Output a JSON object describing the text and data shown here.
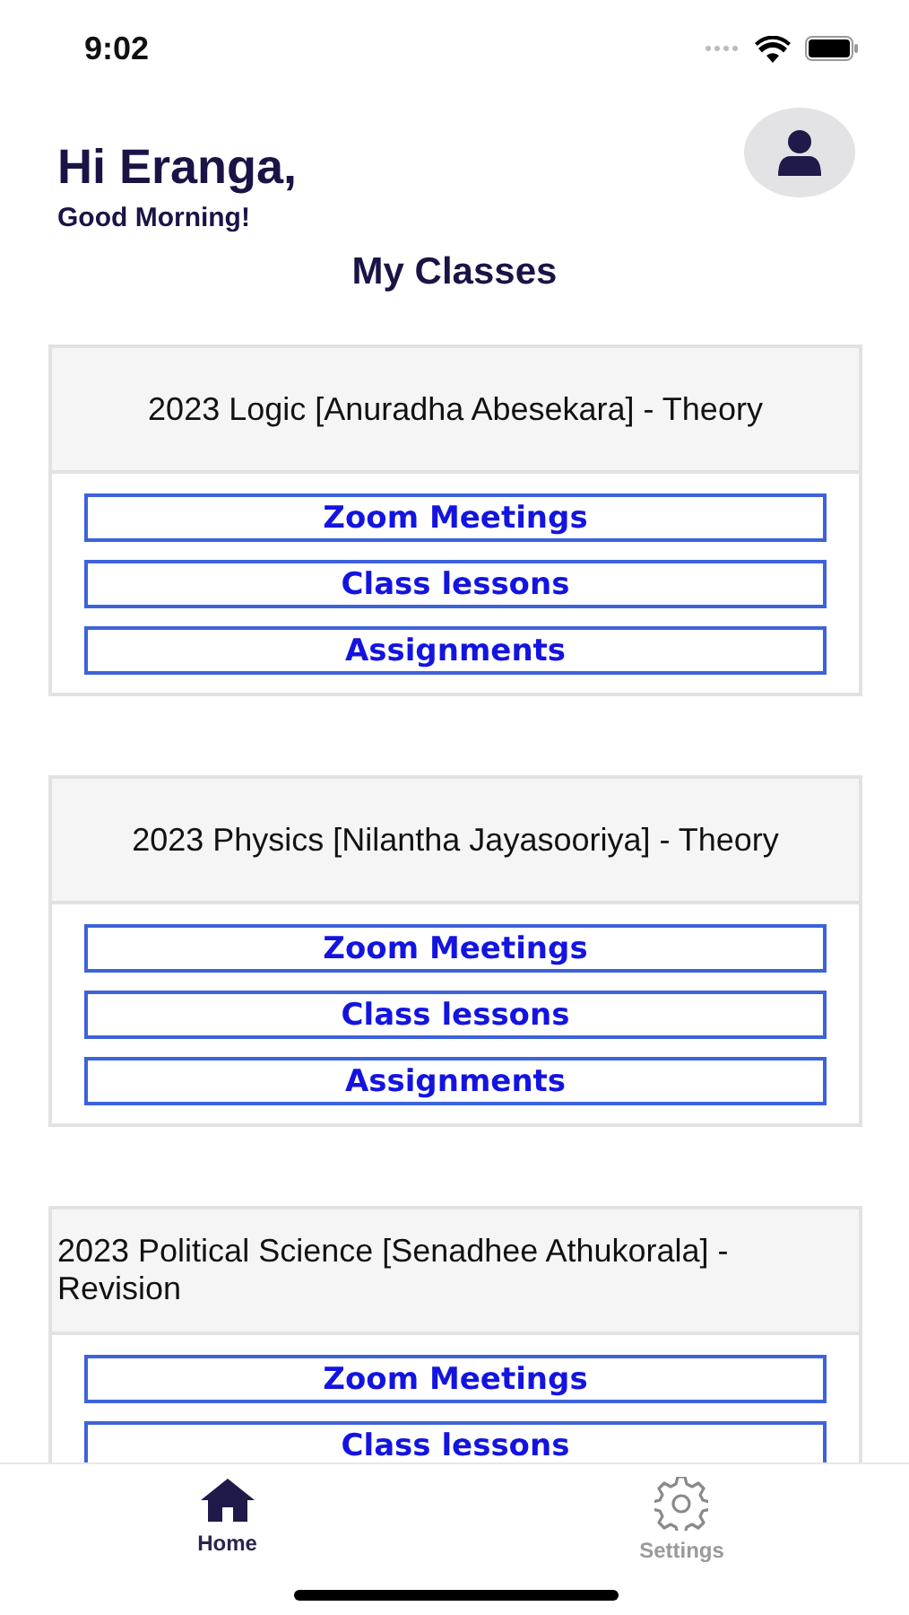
{
  "status_bar": {
    "time": "9:02"
  },
  "header": {
    "greeting": "Hi Eranga,",
    "subtitle": "Good Morning!"
  },
  "section_title": "My Classes",
  "classes": [
    {
      "title": "2023 Logic [Anuradha Abesekara] - Theory",
      "buttons": [
        "Zoom Meetings",
        "Class lessons",
        "Assignments"
      ]
    },
    {
      "title": "2023 Physics [Nilantha Jayasooriya] - Theory",
      "buttons": [
        "Zoom Meetings",
        "Class lessons",
        "Assignments"
      ]
    },
    {
      "title": "2023 Political Science [Senadhee Athukorala] - Revision",
      "buttons": [
        "Zoom Meetings",
        "Class lessons"
      ]
    }
  ],
  "tab_bar": [
    {
      "label": "Home",
      "kind": "home",
      "selected": true
    },
    {
      "label": "Settings",
      "kind": "settings",
      "selected": false
    }
  ]
}
